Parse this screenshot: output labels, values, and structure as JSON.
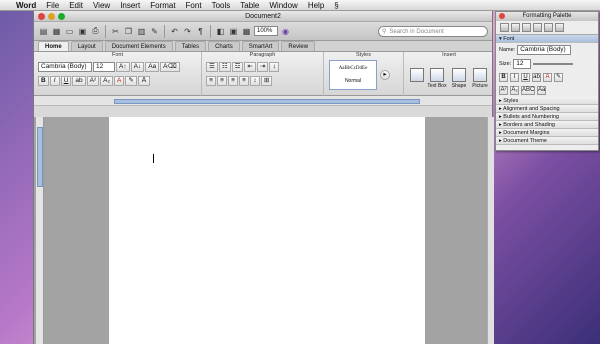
{
  "menubar": {
    "apple": "",
    "app": "Word",
    "items": [
      "File",
      "Edit",
      "View",
      "Insert",
      "Format",
      "Font",
      "Tools",
      "Table",
      "Window",
      "Help"
    ],
    "script": "§"
  },
  "window": {
    "title": "Document2"
  },
  "toolbar": {
    "zoom": "100%",
    "search_placeholder": "Search in Document",
    "paragraph_mark": "¶"
  },
  "tabs": [
    "Home",
    "Layout",
    "Document Elements",
    "Tables",
    "Charts",
    "SmartArt",
    "Review"
  ],
  "ribbon": {
    "groups": {
      "font": "Font",
      "paragraph": "Paragraph",
      "styles": "Styles",
      "insert": "Insert"
    },
    "font_name": "Cambria (Body)",
    "font_size": "12",
    "bold": "B",
    "italic": "I",
    "underline": "U",
    "font_color": "A",
    "style_sample": "AaBbCcDdEe",
    "style_name": "Normal",
    "textbox": "Text Box",
    "shape": "Shape",
    "picture": "Picture"
  },
  "palette": {
    "title": "Formatting Palette",
    "font_section": "Font",
    "name_label": "Name:",
    "name_value": "Cambria (Body)",
    "size_label": "Size:",
    "size_value": "12",
    "b": "B",
    "i": "I",
    "u": "U",
    "a": "A",
    "abc": "ABC",
    "sections": [
      "Styles",
      "Alignment and Spacing",
      "Bullets and Numbering",
      "Borders and Shading",
      "Document Margins",
      "Document Theme"
    ]
  }
}
